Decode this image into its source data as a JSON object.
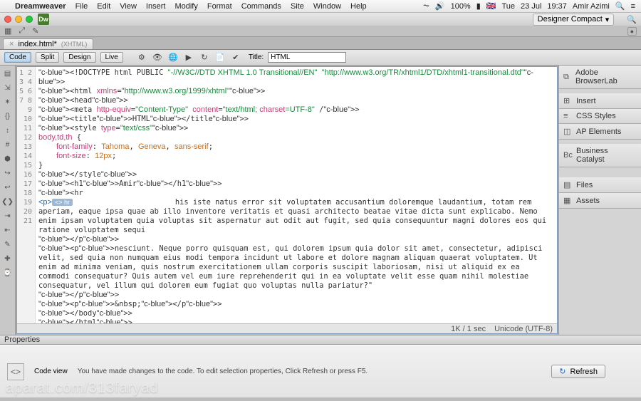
{
  "mac_menu": {
    "app": "Dreamweaver",
    "items": [
      "File",
      "Edit",
      "View",
      "Insert",
      "Modify",
      "Format",
      "Commands",
      "Site",
      "Window",
      "Help"
    ],
    "right": {
      "battery": "100%",
      "flag": "🇬🇧",
      "day": "Tue",
      "date": "23 Jul",
      "time": "19:37",
      "user": "Amir Azimi"
    }
  },
  "workspace": {
    "label": "Designer Compact"
  },
  "doc_tab": {
    "name": "index.html*",
    "doctype": "(XHTML)"
  },
  "view_buttons": {
    "code": "Code",
    "split": "Split",
    "design": "Design",
    "live": "Live"
  },
  "title_field": {
    "label": "Title:",
    "value": "HTML"
  },
  "panels": [
    {
      "icon": "⧉",
      "label": "Adobe BrowserLab"
    },
    {
      "icon": "⊞",
      "label": "Insert"
    },
    {
      "icon": "≡",
      "label": "CSS Styles"
    },
    {
      "icon": "◫",
      "label": "AP Elements"
    },
    {
      "icon": "Bc",
      "label": "Business Catalyst"
    },
    {
      "icon": "▤",
      "label": "Files"
    },
    {
      "icon": "▦",
      "label": "Assets"
    }
  ],
  "status": {
    "size": "1K / 1 sec",
    "encoding": "Unicode (UTF-8)"
  },
  "properties": {
    "title": "Properties",
    "mode": "Code view",
    "message": "You have made changes to the code. To edit selection properties, Click Refresh or press F5.",
    "refresh": "Refresh"
  },
  "code": {
    "hint_tag": "<> hr",
    "lines": [
      "<!DOCTYPE html PUBLIC \"-//W3C//DTD XHTML 1.0 Transitional//EN\" \"http://www.w3.org/TR/xhtml1/DTD/xhtml1-transitional.dtd\">",
      "<html xmlns=\"http://www.w3.org/1999/xhtml\">",
      "<head>",
      "<meta http-equiv=\"Content-Type\" content=\"text/html; charset=UTF-8\" />",
      "<title>HTML</title>",
      "<style type=\"text/css\">",
      "body,td,th {",
      "    font-family: Tahoma, Geneva, sans-serif;",
      "    font-size: 12px;",
      "}",
      "</style>",
      "<h1>Amir</h1>",
      "<hr",
      "<p>                       his iste natus error sit voluptatem accusantium doloremque laudantium, totam rem aperiam, eaque ipsa quae ab illo inventore veritatis et quasi architecto beatae vitae dicta sunt explicabo. Nemo enim ipsam voluptatem quia voluptas sit aspernatur aut odit aut fugit, sed quia consequuntur magni dolores eos qui ratione voluptatem sequi",
      "</p>",
      "<p>nesciunt. Neque porro quisquam est, qui dolorem ipsum quia dolor sit amet, consectetur, adipisci velit, sed quia non numquam eius modi tempora incidunt ut labore et dolore magnam aliquam quaerat voluptatem. Ut enim ad minima veniam, quis nostrum exercitationem ullam corporis suscipit laboriosam, nisi ut aliquid ex ea commodi consequatur? Quis autem vel eum iure reprehenderit qui in ea voluptate velit esse quam nihil molestiae consequatur, vel illum qui dolorem eum fugiat quo voluptas nulla pariatur?\"",
      "</p>",
      "<p>&nbsp;</p>",
      "</body>",
      "</html>",
      ""
    ]
  },
  "watermark": "aparat.com/313faryad"
}
